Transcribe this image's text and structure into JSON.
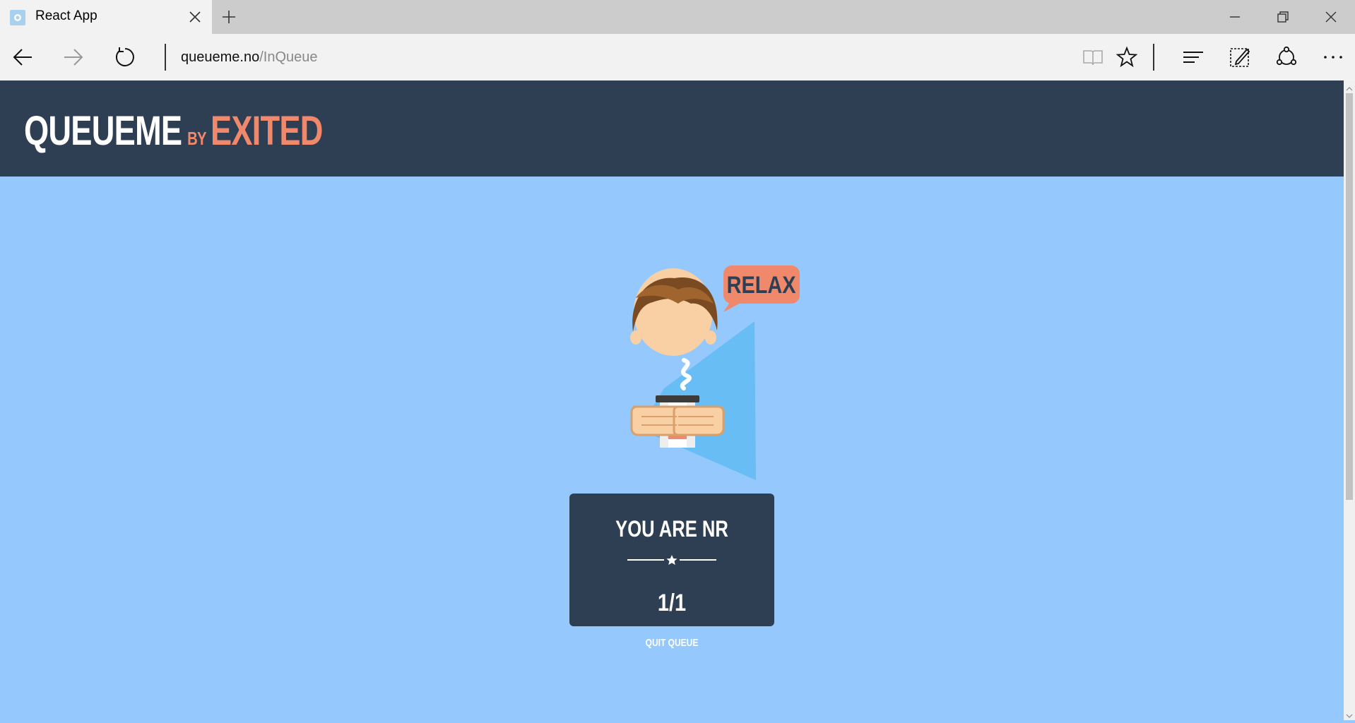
{
  "browser": {
    "tab_title": "React App",
    "url_host": "queueme.no",
    "url_path": "/InQueue"
  },
  "header": {
    "logo_main": "QUEUEME",
    "logo_by": "BY",
    "logo_brand": "EXITED"
  },
  "illustration": {
    "speech": "RELAX"
  },
  "queue": {
    "title": "YOU ARE NR",
    "number": "1/1",
    "quit_label": "QUIT QUEUE"
  },
  "colors": {
    "header_bg": "#2e3e53",
    "page_bg": "#95c9fd",
    "accent": "#f0896b"
  },
  "icons": [
    "back-icon",
    "forward-icon",
    "refresh-icon",
    "reading-view-icon",
    "favorite-star-icon",
    "hub-icon",
    "web-note-icon",
    "share-icon",
    "more-icon",
    "minimize-icon",
    "restore-icon",
    "close-icon",
    "new-tab-icon",
    "tab-close-icon"
  ]
}
